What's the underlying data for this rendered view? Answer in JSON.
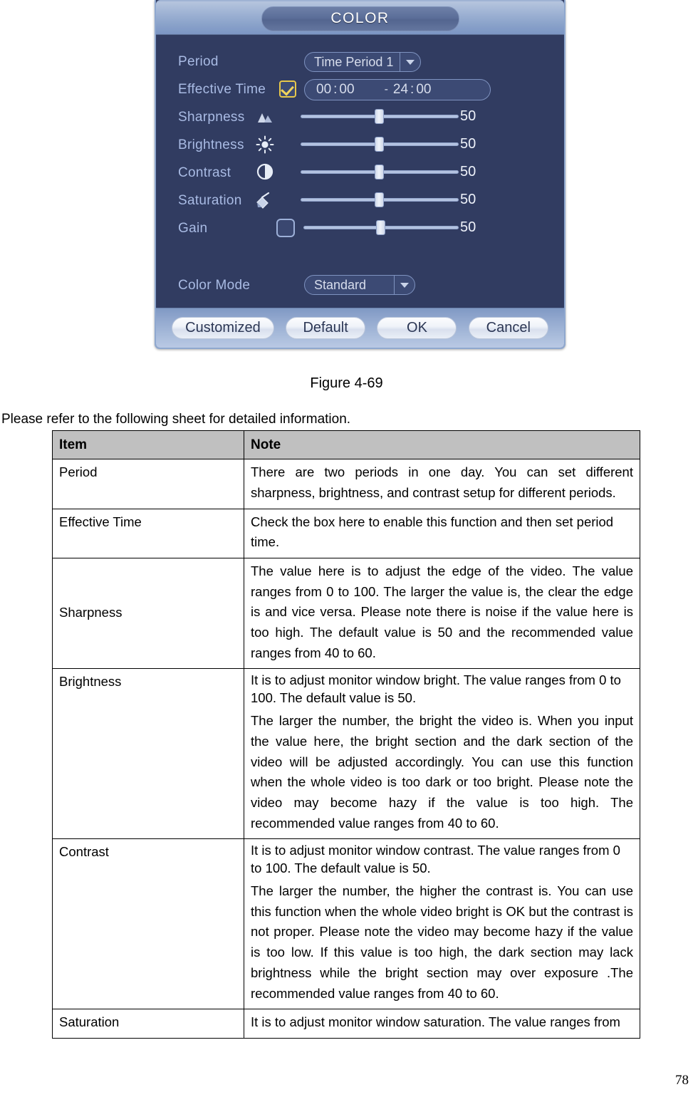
{
  "dialog": {
    "title": "COLOR",
    "period": {
      "label": "Period",
      "value": "Time Period 1",
      "icon": "chevron-down-icon"
    },
    "effective_time": {
      "label": "Effective Time",
      "checked": true,
      "start_hour": "00",
      "start_min": "00",
      "separator": "-",
      "end_hour": "24",
      "end_min": "00"
    },
    "sliders": [
      {
        "label": "Sharpness",
        "icon": "mountain-icon",
        "value": "50",
        "percent": 50
      },
      {
        "label": "Brightness",
        "icon": "sun-icon",
        "value": "50",
        "percent": 50
      },
      {
        "label": "Contrast",
        "icon": "half-circle-icon",
        "value": "50",
        "percent": 50
      },
      {
        "label": "Saturation",
        "icon": "paint-bucket-icon",
        "value": "50",
        "percent": 50
      },
      {
        "label": "Gain",
        "icon": "checkbox-unchecked-icon",
        "value": "50",
        "percent": 50
      }
    ],
    "color_mode": {
      "label": "Color Mode",
      "value": "Standard"
    },
    "buttons": {
      "customized": "Customized",
      "default": "Default",
      "ok": "OK",
      "cancel": "Cancel"
    },
    "colors": {
      "body_bg": "#313c61",
      "title_bar": "#9fb3d4",
      "label_text": "#a9bbe4",
      "checkbox_accent": "#e8c84a",
      "slider_track": "#b3c2e0"
    }
  },
  "document": {
    "figure_caption": "Figure 4-69",
    "intro": "Please refer to the following sheet for detailed information.",
    "page_number": "78",
    "table": {
      "headers": [
        "Item",
        "Note"
      ],
      "rows": [
        {
          "item": "Period",
          "note": [
            "There are two periods in one day. You can set different sharpness, brightness, and contrast setup for different periods."
          ]
        },
        {
          "item": "Effective Time",
          "note": [
            "Check the box here to enable this function and then set period time."
          ]
        },
        {
          "item": "Sharpness",
          "note": [
            "The value here is to adjust the edge of the video. The value ranges from 0 to 100. The larger the value is, the clear the edge is and vice versa. Please note there is noise if the value here is too high. The default value is 50 and the recommended value ranges from 40 to 60."
          ]
        },
        {
          "item": "Brightness",
          "note": [
            "It is to adjust monitor window bright. The value ranges from 0 to 100. The default value is 50.",
            "The larger the number, the bright the video is. When you input the value here, the bright section and the dark section of the video will be adjusted accordingly.   You can use this function when the whole video is too dark or too bright. Please note the video may become hazy if the value is too high. The recommended value ranges from 40 to 60."
          ]
        },
        {
          "item": "Contrast",
          "note": [
            "It is to adjust monitor window contrast. The value ranges from 0 to 100. The default value is 50.",
            "The larger the number, the higher the contrast is. You can use this function when the whole video bright is OK but the contrast is not proper. Please note the video may become hazy if the value is too low. If this value is too high, the dark section may lack brightness while the bright section may over exposure .The recommended value ranges from 40 to 60."
          ]
        },
        {
          "item": "Saturation",
          "note": [
            "It is to adjust monitor window saturation. The value ranges from"
          ]
        }
      ]
    }
  }
}
